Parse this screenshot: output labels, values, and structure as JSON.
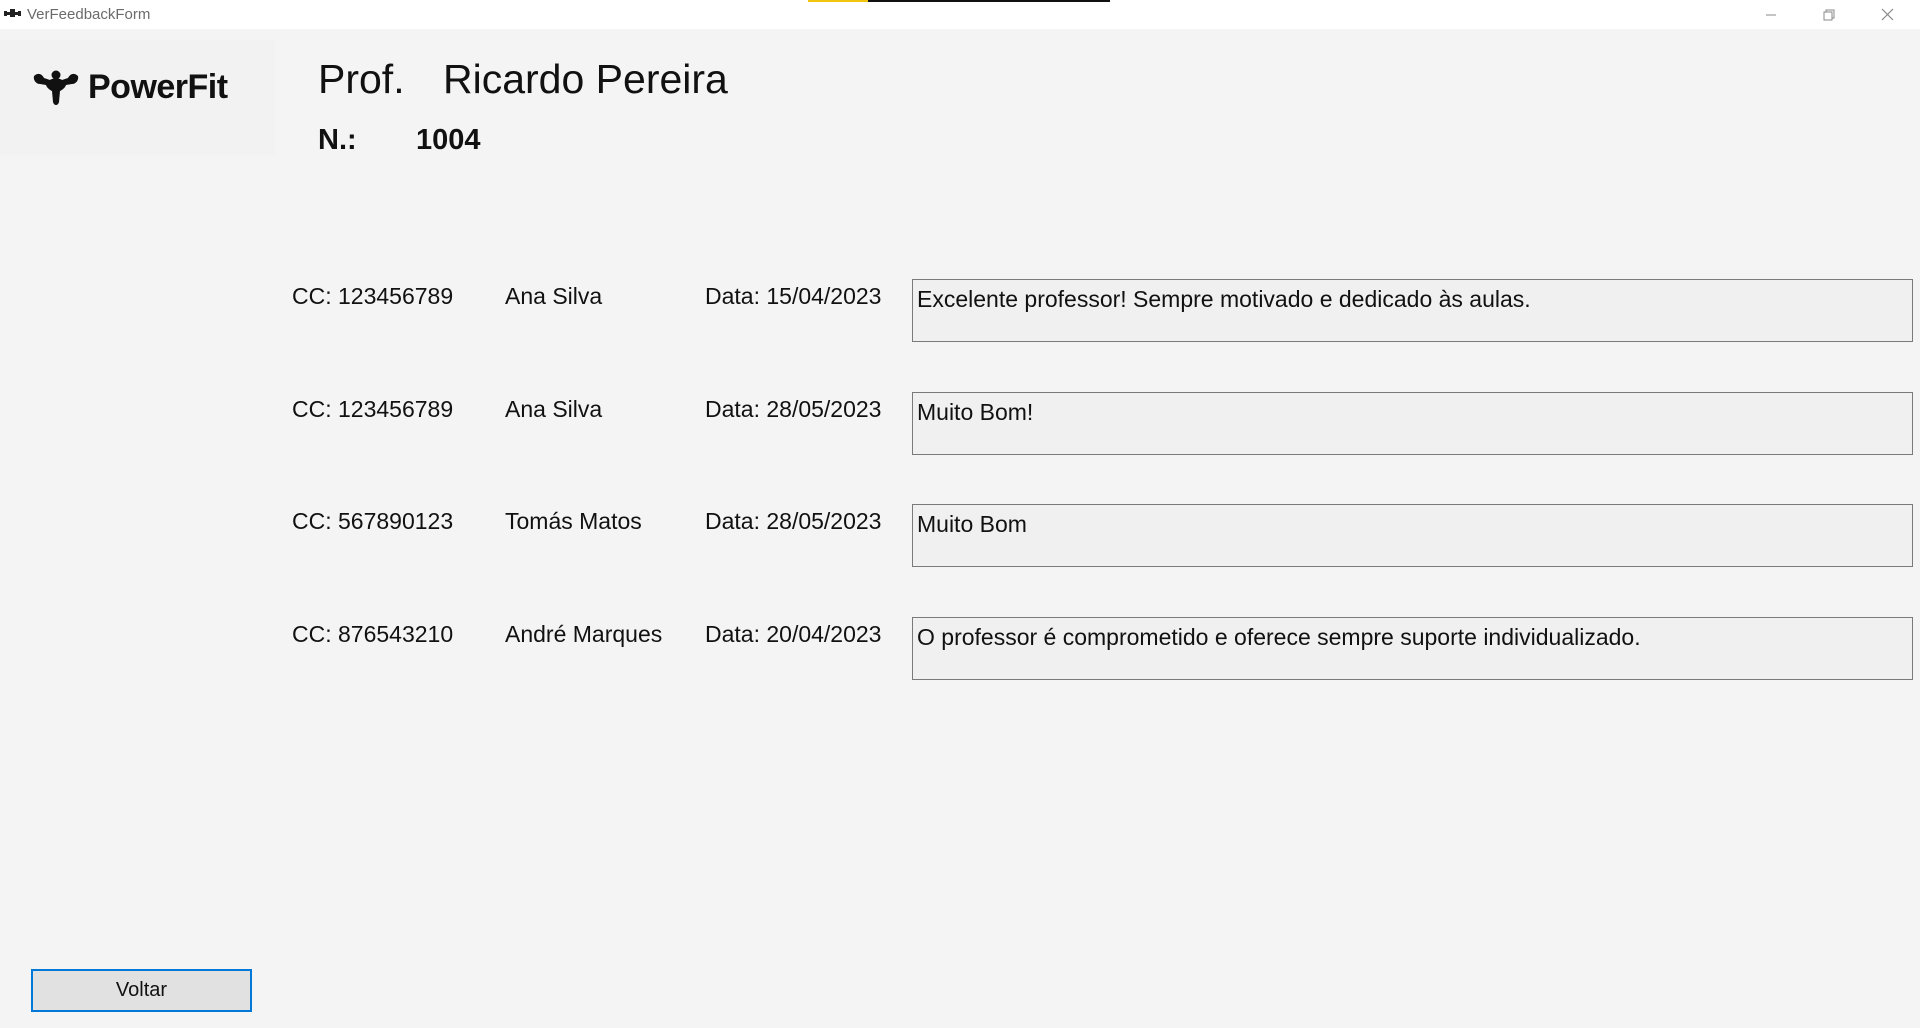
{
  "window": {
    "title": "VerFeedbackForm",
    "controls": {
      "minimize_icon": "minimize-icon",
      "maximize_icon": "restore-icon",
      "close_icon": "close-icon"
    }
  },
  "logo": {
    "text": "PowerFit",
    "icon": "muscle-icon"
  },
  "header": {
    "prof_label": "Prof.",
    "prof_name": "Ricardo Pereira",
    "number_label": "N.:",
    "number_value": "1004"
  },
  "feedbacks": [
    {
      "cc": "CC: 123456789",
      "name": "Ana Silva",
      "date": "Data: 15/04/2023",
      "text": "Excelente professor! Sempre motivado e dedicado às aulas."
    },
    {
      "cc": "CC: 123456789",
      "name": "Ana Silva",
      "date": "Data: 28/05/2023",
      "text": "Muito Bom!"
    },
    {
      "cc": "CC: 567890123",
      "name": "Tomás Matos",
      "date": "Data: 28/05/2023",
      "text": "Muito Bom"
    },
    {
      "cc": "CC: 876543210",
      "name": "André Marques",
      "date": "Data: 20/04/2023",
      "text": "O professor é comprometido e oferece sempre suporte individualizado."
    }
  ],
  "back_button": {
    "label": "Voltar"
  },
  "colors": {
    "background": "#f4f4f4",
    "button_border": "#0078d7",
    "textbox_bg": "#f0f0f0"
  }
}
